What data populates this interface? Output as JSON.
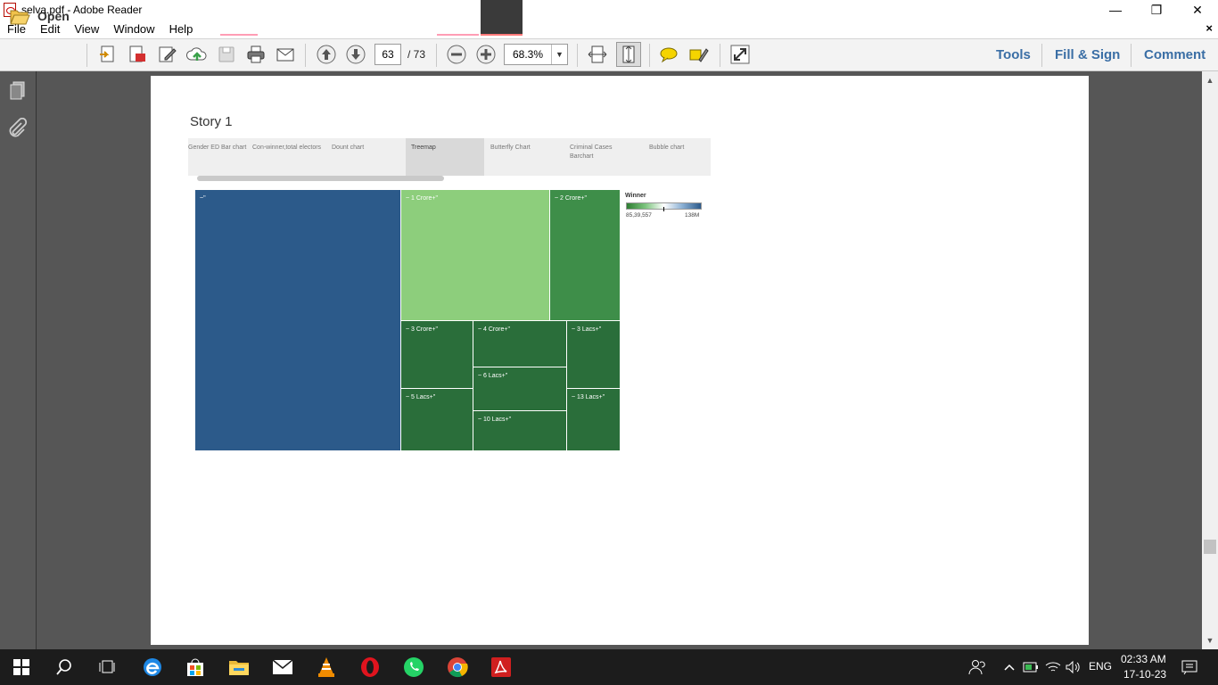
{
  "window": {
    "title": "selva.pdf - Adobe Reader",
    "minimize_glyph": "—",
    "maximize_glyph": "❐",
    "close_glyph": "✕"
  },
  "menu": {
    "items": [
      "File",
      "Edit",
      "View",
      "Window",
      "Help"
    ],
    "close_doc": "×"
  },
  "toolbar": {
    "open_label": "Open",
    "current_page": "63",
    "total_pages": "/ 73",
    "zoom": "68.3%",
    "zoom_dropdown": "▼",
    "tools_label": "Tools",
    "fill_sign_label": "Fill & Sign",
    "comment_label": "Comment",
    "icons": [
      "open-folder-icon",
      "create-pdf-icon",
      "export-pdf-icon",
      "edit-icon",
      "upload-icon",
      "save-icon",
      "print-icon",
      "email-icon",
      "previous-page-icon",
      "next-page-icon",
      "zoom-out-icon",
      "zoom-in-icon",
      "fit-page-icon",
      "fit-width-icon",
      "comment-icon",
      "highlight-icon",
      "expand-icon"
    ]
  },
  "scrollbar": {
    "up_arrow": "▲",
    "down_arrow": "▼"
  },
  "story": {
    "title": "Story 1",
    "tabs": [
      {
        "label": "Gender ED Bar chart",
        "active": false
      },
      {
        "label": "Con-winner,total electors",
        "active": false
      },
      {
        "label": "Dount chart",
        "active": false
      },
      {
        "label": "Treemap",
        "active": true
      },
      {
        "label": "Butterfly Chart",
        "active": false
      },
      {
        "label": "Criminal Cases Barchart",
        "active": false
      },
      {
        "label": "Bubble chart",
        "active": false
      }
    ]
  },
  "chart_data": {
    "type": "treemap",
    "legend": {
      "title": "Winner",
      "min_label": "85,39,557",
      "max_label": "138M",
      "colors": [
        "#2e7d32",
        "#ffffff",
        "#2c5a8a"
      ]
    },
    "cells": [
      {
        "label": "~\"",
        "color": "#2c5a8a"
      },
      {
        "label": "~ 1 Crore+\"",
        "color": "#8dce7c"
      },
      {
        "label": "~ 2 Crore+\"",
        "color": "#3e8e49"
      },
      {
        "label": "~ 3 Crore+\"",
        "color": "#2a6e3a"
      },
      {
        "label": "~ 4 Crore+\"",
        "color": "#2a6e3a"
      },
      {
        "label": "~ 3 Lacs+\"",
        "color": "#2a6e3a"
      },
      {
        "label": "~ 6 Lacs+\"",
        "color": "#2a6e3a"
      },
      {
        "label": "~ 5 Lacs+\"",
        "color": "#2a6e3a"
      },
      {
        "label": "~ 13 Lacs+\"",
        "color": "#2a6e3a"
      },
      {
        "label": "~ 10 Lacs+\"",
        "color": "#2a6e3a"
      }
    ]
  },
  "taskbar": {
    "apps": [
      "start-icon",
      "search-icon",
      "task-view-icon",
      "edge-icon",
      "store-icon",
      "file-explorer-icon",
      "mail-icon",
      "vlc-icon",
      "opera-icon",
      "whatsapp-icon",
      "chrome-icon",
      "acrobat-icon"
    ],
    "language": "ENG",
    "time": "02:33 AM",
    "date": "17-10-23"
  }
}
